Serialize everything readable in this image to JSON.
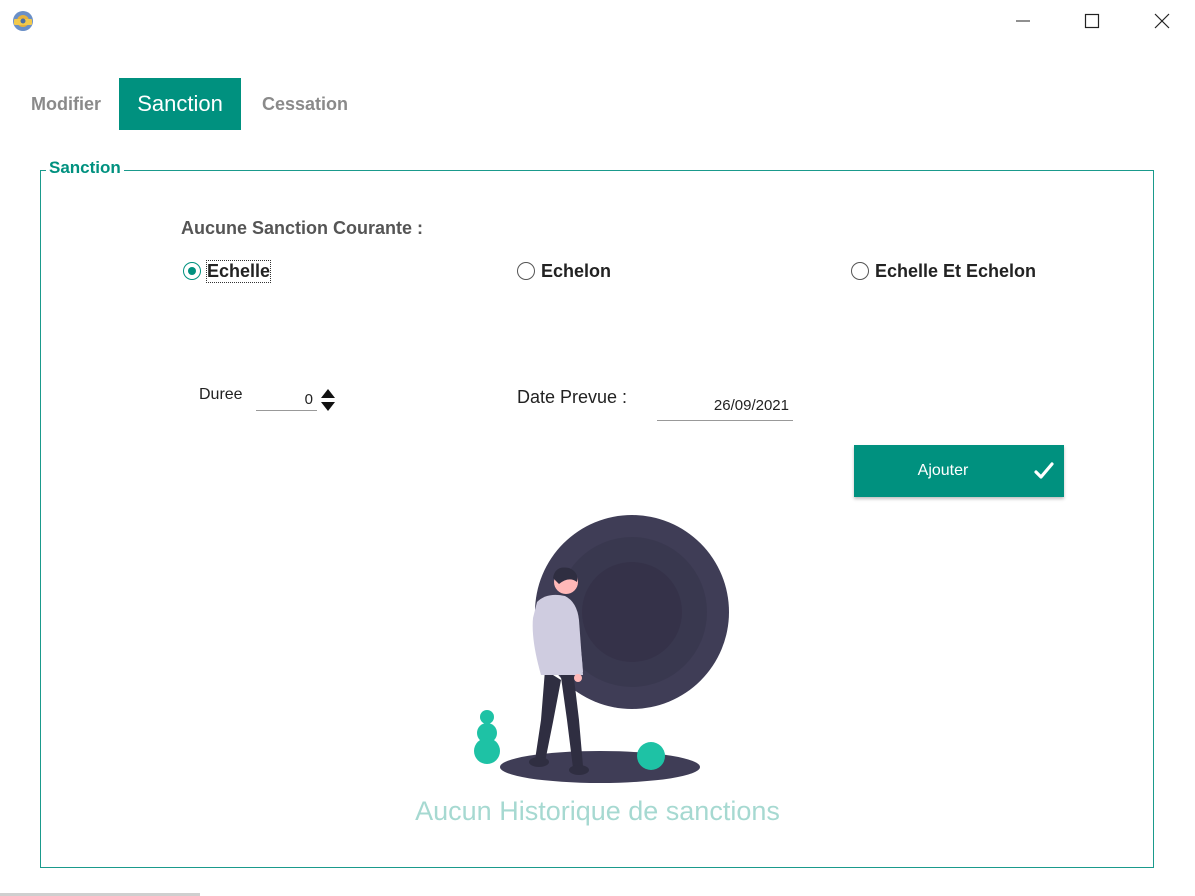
{
  "window": {
    "app_icon": "app-icon",
    "controls": [
      "minimize-icon",
      "maximize-icon",
      "close-icon"
    ]
  },
  "tabs": [
    {
      "label": "Modifier",
      "active": false
    },
    {
      "label": "Sanction",
      "active": true
    },
    {
      "label": "Cessation",
      "active": false
    }
  ],
  "group": {
    "title": "Sanction",
    "status_label": "Aucune Sanction Courante :",
    "radios": [
      {
        "label": "Echelle",
        "checked": true
      },
      {
        "label": "Echelon",
        "checked": false
      },
      {
        "label": "Echelle Et Echelon",
        "checked": false
      }
    ],
    "duree": {
      "label": "Duree",
      "value": "0"
    },
    "date": {
      "label": "Date Prevue :",
      "value": "26/09/2021"
    },
    "add_button": {
      "label": "Ajouter",
      "icon": "check-icon"
    },
    "empty_state": {
      "icon": "empty-illustration",
      "text": "Aucun Historique de sanctions"
    }
  },
  "colors": {
    "accent": "#00917f",
    "accent_light": "#a6d9d1",
    "illustration_dark": "#3f3d56",
    "illustration_teal": "#1ec2a5"
  }
}
